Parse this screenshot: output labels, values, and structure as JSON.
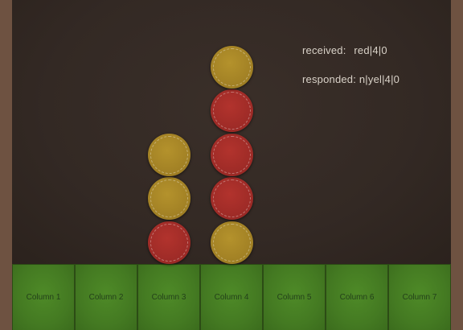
{
  "status": {
    "received_label": "received:",
    "received_value": "red|4|0",
    "responded_label": "responded:",
    "responded_value": "n|yel|4|0"
  },
  "columns": [
    {
      "label": "Column 1",
      "discs": []
    },
    {
      "label": "Column 2",
      "discs": []
    },
    {
      "label": "Column 3",
      "discs": [
        "red",
        "yellow",
        "yellow"
      ]
    },
    {
      "label": "Column 4",
      "discs": [
        "yellow",
        "red",
        "red",
        "red",
        "yellow"
      ]
    },
    {
      "label": "Column 5",
      "discs": []
    },
    {
      "label": "Column 6",
      "discs": []
    },
    {
      "label": "Column 7",
      "discs": []
    }
  ],
  "colors": {
    "red_disc": "#9c2a26",
    "yellow_disc": "#a07f24",
    "board": "#332924",
    "button": "#447a22"
  }
}
